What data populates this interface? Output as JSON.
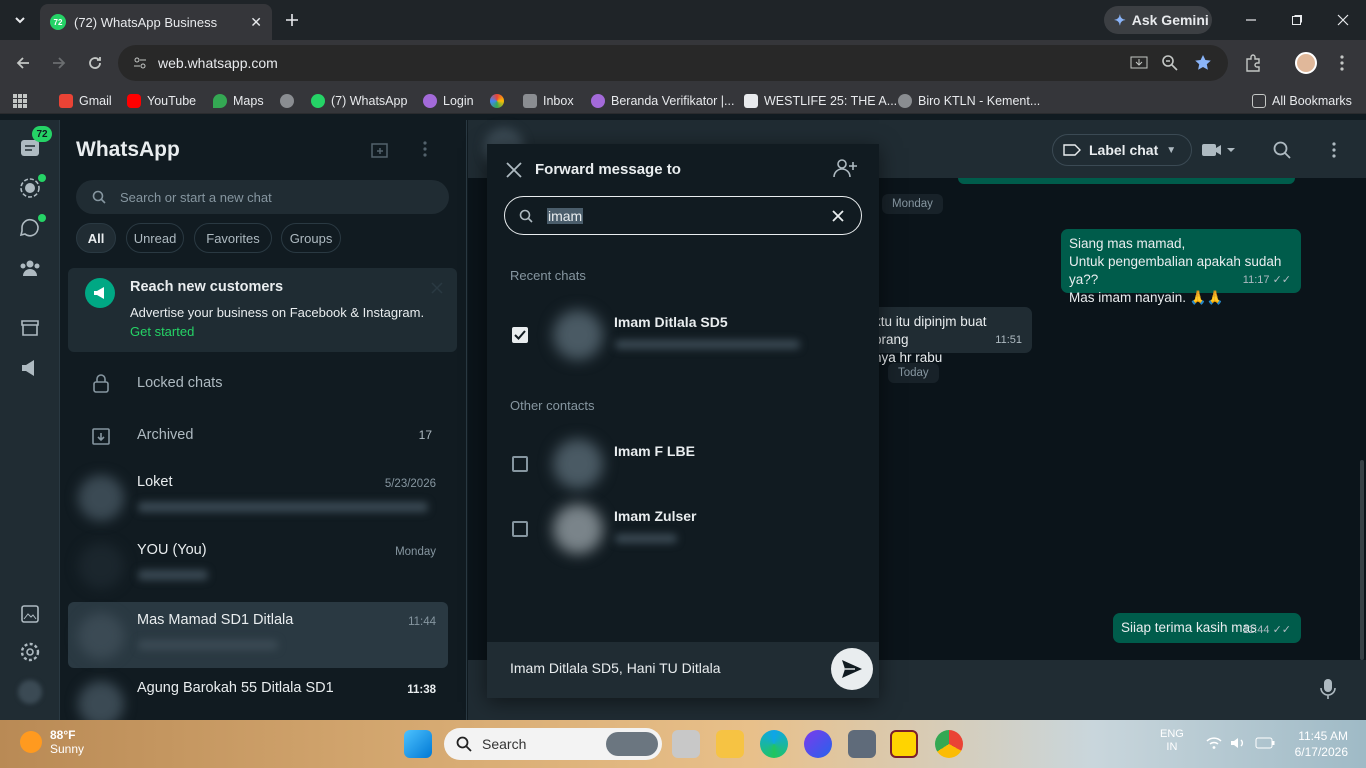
{
  "browser": {
    "tab_title": "(72) WhatsApp Business",
    "tab_badge": "72",
    "gemini_label": "Ask Gemini",
    "url": "web.whatsapp.com",
    "bookmarks": [
      "Gmail",
      "YouTube",
      "Maps",
      "(7) WhatsApp",
      "Login",
      "Inbox",
      "Beranda Verifikator |...",
      "WESTLIFE 25: THE A...",
      "Biro KTLN - Kement..."
    ],
    "all_bookmarks": "All Bookmarks"
  },
  "rail": {
    "badge": "72"
  },
  "chatlist": {
    "title": "WhatsApp",
    "search_placeholder": "Search or start a new chat",
    "filters": [
      "All",
      "Unread",
      "Favorites",
      "Groups"
    ],
    "promo": {
      "title": "Reach new customers",
      "text": "Advertise your business on Facebook & Instagram.",
      "link": "Get started"
    },
    "locked": "Locked chats",
    "archived": "Archived",
    "archived_count": "17",
    "chats": [
      {
        "name": "Loket",
        "time": "5/23/2026"
      },
      {
        "name": "YOU (You)",
        "time": "Monday"
      },
      {
        "name": "Mas Mamad SD1 Ditlala",
        "time": "11:44"
      },
      {
        "name": "Agung Barokah 55 Ditlala SD1",
        "time": "11:38"
      }
    ]
  },
  "conversation": {
    "label_chat": "Label chat",
    "day_monday": "Monday",
    "day_today": "Today",
    "msg1_line1": "Siang mas mamad,",
    "msg1_line2": "Untuk pengembalian apakah sudah ya??",
    "msg1_line3": "Mas imam nanyain. 🙏🙏",
    "msg1_time": "11:17",
    "msg2_line1": "ktu itu dipinjm buat orang",
    "msg2_line2": "nya hr rabu",
    "msg2_time": "11:51",
    "msg3": "Siiap terima kasih mas",
    "msg3_time": "11:44"
  },
  "modal": {
    "title": "Forward message to",
    "search_value": "imam",
    "recent_label": "Recent chats",
    "other_label": "Other contacts",
    "contacts": [
      {
        "name": "Imam Ditlala SD5",
        "checked": true
      },
      {
        "name": "Imam F LBE",
        "checked": false
      },
      {
        "name": "Imam Zulser",
        "checked": false
      }
    ],
    "selected": "Imam Ditlala SD5, Hani TU Ditlala"
  },
  "taskbar": {
    "temp": "88°F",
    "condition": "Sunny",
    "search": "Search",
    "lang1": "ENG",
    "lang2": "IN",
    "time": "11:45 AM",
    "date": "6/17/2026"
  },
  "colors": {
    "accent": "#25d366",
    "outgoing": "#005c4b",
    "panel": "#111b21"
  }
}
